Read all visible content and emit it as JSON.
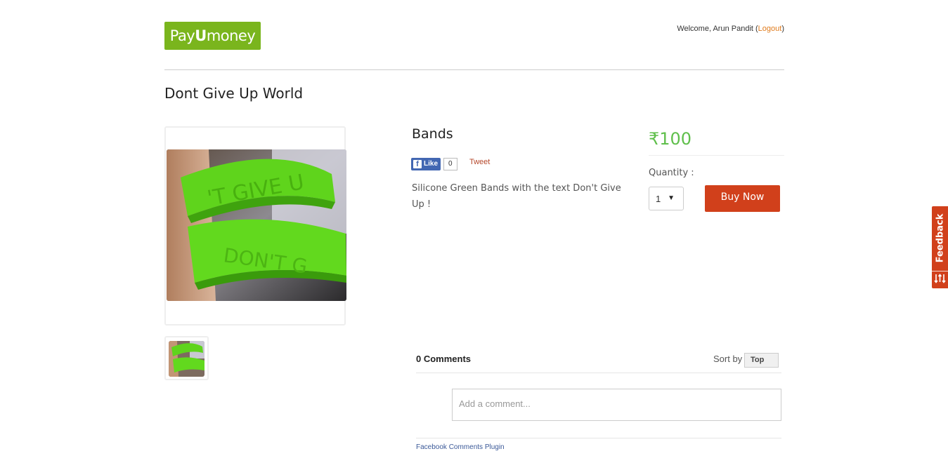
{
  "header": {
    "logo": {
      "part1": "Pay",
      "part2": "U",
      "part3": "money"
    },
    "welcome_text": "Welcome, Arun Pandit (",
    "logout_label": "Logout",
    "welcome_close": ")"
  },
  "store": {
    "title": "Dont Give Up World"
  },
  "product": {
    "name": "Bands",
    "description": "Silicone Green Bands with the text Don't Give Up !",
    "price": "₹100",
    "quantity_label": "Quantity :",
    "quantity_value": "1",
    "buy_label": "Buy Now"
  },
  "social": {
    "like_label": "Like",
    "like_count": "0",
    "tweet_label": "Tweet"
  },
  "comments": {
    "count_label": "0 Comments",
    "sort_label": "Sort by",
    "sort_value": "Top",
    "placeholder": "Add a comment...",
    "plugin_label": "Facebook Comments Plugin"
  },
  "feedback": {
    "label": "Feedback"
  },
  "colors": {
    "brand_green": "#7ab51d",
    "price_green": "#5fbf4b",
    "accent_orange": "#d1401b",
    "facebook_blue": "#4267b2"
  }
}
